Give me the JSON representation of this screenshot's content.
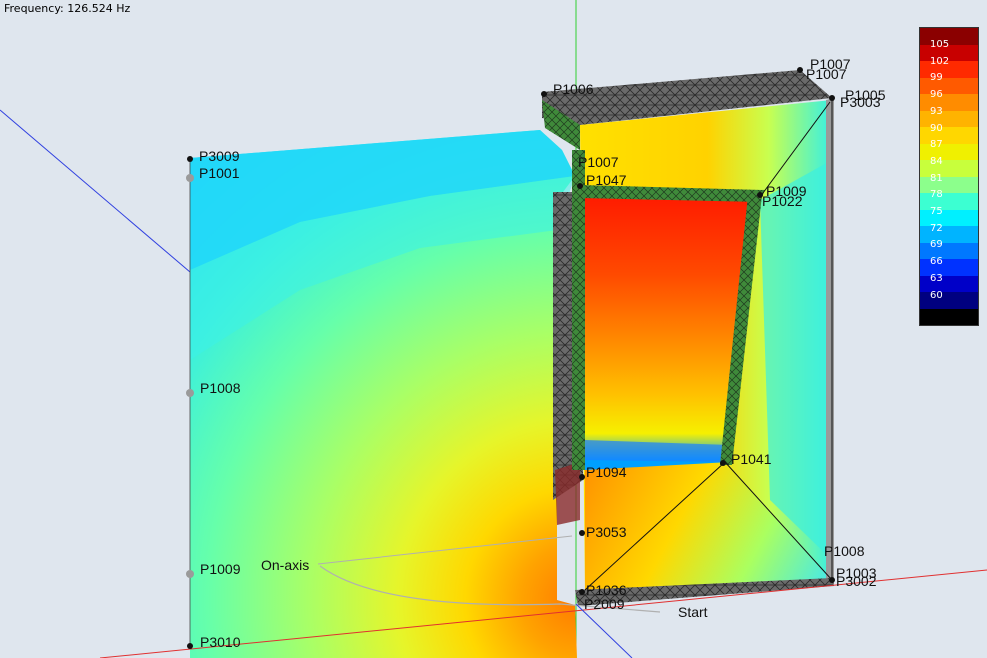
{
  "header": {
    "frequency": "Frequency: 126.524 Hz"
  },
  "legend": {
    "labels": [
      "105",
      "102",
      "99",
      "96",
      "93",
      "90",
      "87",
      "84",
      "81",
      "78",
      "75",
      "72",
      "69",
      "66",
      "63",
      "60"
    ],
    "colors": [
      "#8b0000",
      "#c80000",
      "#ff2a00",
      "#ff5a00",
      "#ff8c00",
      "#ffb300",
      "#ffd700",
      "#f0f000",
      "#c8ff3c",
      "#8cff8c",
      "#3cffd2",
      "#00f0ff",
      "#00b4ff",
      "#0078ff",
      "#0032ff",
      "#0000c8",
      "#000080",
      "#000000"
    ]
  },
  "points": [
    {
      "id": "p1006",
      "label": "P1006"
    },
    {
      "id": "p1007a",
      "label": "P1007"
    },
    {
      "id": "p1007b",
      "label": "P1007"
    },
    {
      "id": "p1005",
      "label": "P1005"
    },
    {
      "id": "p3003",
      "label": "P3003"
    },
    {
      "id": "p3009",
      "label": "P3009"
    },
    {
      "id": "p1001",
      "label": "P1001"
    },
    {
      "id": "p1007c",
      "label": "P1007"
    },
    {
      "id": "p1047",
      "label": "P1047"
    },
    {
      "id": "p1009",
      "label": "P1009"
    },
    {
      "id": "p1022",
      "label": "P1022"
    },
    {
      "id": "p1008",
      "label": "P1008"
    },
    {
      "id": "p1094",
      "label": "P1094"
    },
    {
      "id": "p1041",
      "label": "P1041"
    },
    {
      "id": "p1009b",
      "label": "P1009"
    },
    {
      "id": "p3053",
      "label": "P3053"
    },
    {
      "id": "p1008b",
      "label": "P1008"
    },
    {
      "id": "p1003",
      "label": "P1003"
    },
    {
      "id": "p3002",
      "label": "P3002"
    },
    {
      "id": "p1036",
      "label": "P1036"
    },
    {
      "id": "p2009",
      "label": "P2009"
    },
    {
      "id": "p3010",
      "label": "P3010"
    }
  ],
  "annotations": {
    "on_axis": "On-axis",
    "start": "Start"
  },
  "colors": {
    "background": "#dfe6ee",
    "x_axis": "#e03030",
    "y_axis": "#30d030",
    "z_axis": "#3040e0"
  }
}
